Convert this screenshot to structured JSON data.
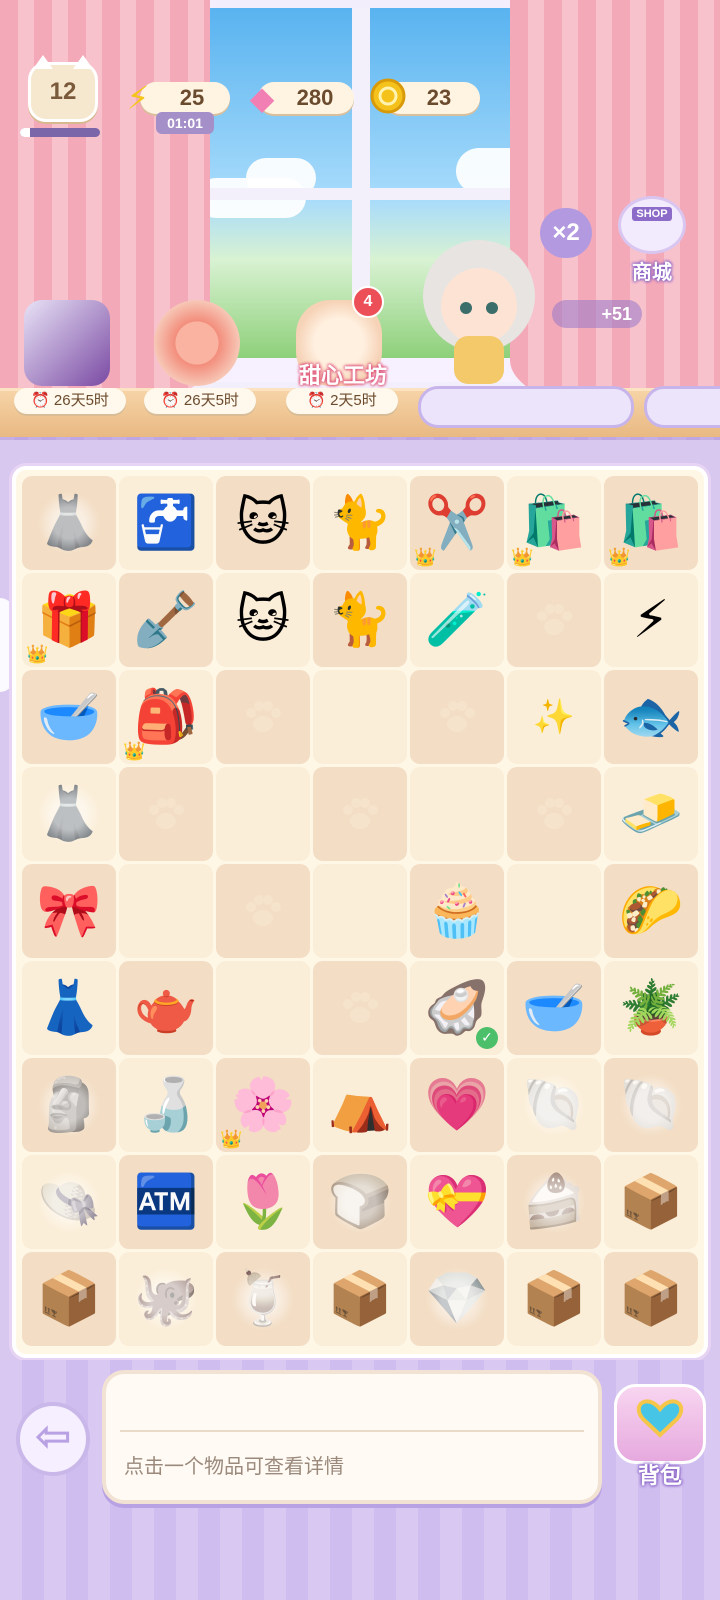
{
  "header": {
    "level": "12",
    "energy": {
      "value": "25",
      "timer": "01:01",
      "icon": "lightning-icon"
    },
    "gems": {
      "value": "280",
      "icon": "gem-icon"
    },
    "coins": {
      "value": "23",
      "icon": "coin-icon"
    },
    "xp_progress": 0.12
  },
  "shop": {
    "label": "商城",
    "sign": "SHOP",
    "multiplier": "×2",
    "coin_reward": "+51"
  },
  "offers": [
    {
      "name": "card-pack",
      "time": "26天5时"
    },
    {
      "name": "strawberry-roll-cake",
      "time": "26天5时"
    },
    {
      "name": "sweet-workshop",
      "title": "甜心工坊",
      "time": "2天5时",
      "badge": "4"
    }
  ],
  "board": {
    "rows": [
      [
        "dress-locked",
        "water-dispenser",
        "siamese-cat",
        "calico-lucky-cat",
        "scissors",
        "gift-bag-pink",
        "gift-bag-pink"
      ],
      [
        "golden-mystery-box",
        "shovel",
        "brown-cat",
        "calico-cat",
        "potion-flask",
        "empty-paw",
        "lightning-bundle"
      ],
      [
        "wooden-bowl",
        "blue-cat-backpack",
        "empty-paw",
        "empty",
        "empty-paw",
        "sparkle-empty",
        "fish-plate"
      ],
      [
        "dress-locked",
        "empty-paw",
        "empty",
        "empty-paw",
        "empty",
        "empty-paw",
        "butter"
      ],
      [
        "pink-gift-box",
        "empty",
        "empty-paw",
        "empty",
        "cream-puff",
        "empty",
        "cat-taco"
      ],
      [
        "clothes-rack",
        "glass-pitcher",
        "empty",
        "empty-paw",
        "pearl-shell",
        "pink-bowl",
        "watering-can"
      ],
      [
        "statue-locked",
        "cream-pitcher",
        "flower-box",
        "teepee-tent",
        "pink-jewel-box",
        "shell-locked",
        "seashell-locked"
      ],
      [
        "hat-locked",
        "vending-machine",
        "flower-swing",
        "bread-locked",
        "pink-jewel-chest",
        "cake-locked",
        "cardboard-box"
      ],
      [
        "cardboard-box",
        "octopus-locked",
        "drink-locked",
        "cardboard-box",
        "earrings-locked",
        "cardboard-box",
        "cardboard-box"
      ]
    ]
  },
  "footer": {
    "info_text": "点击一个物品可查看详情",
    "bag_label": "背包",
    "back_icon": "back-arrow-icon"
  }
}
